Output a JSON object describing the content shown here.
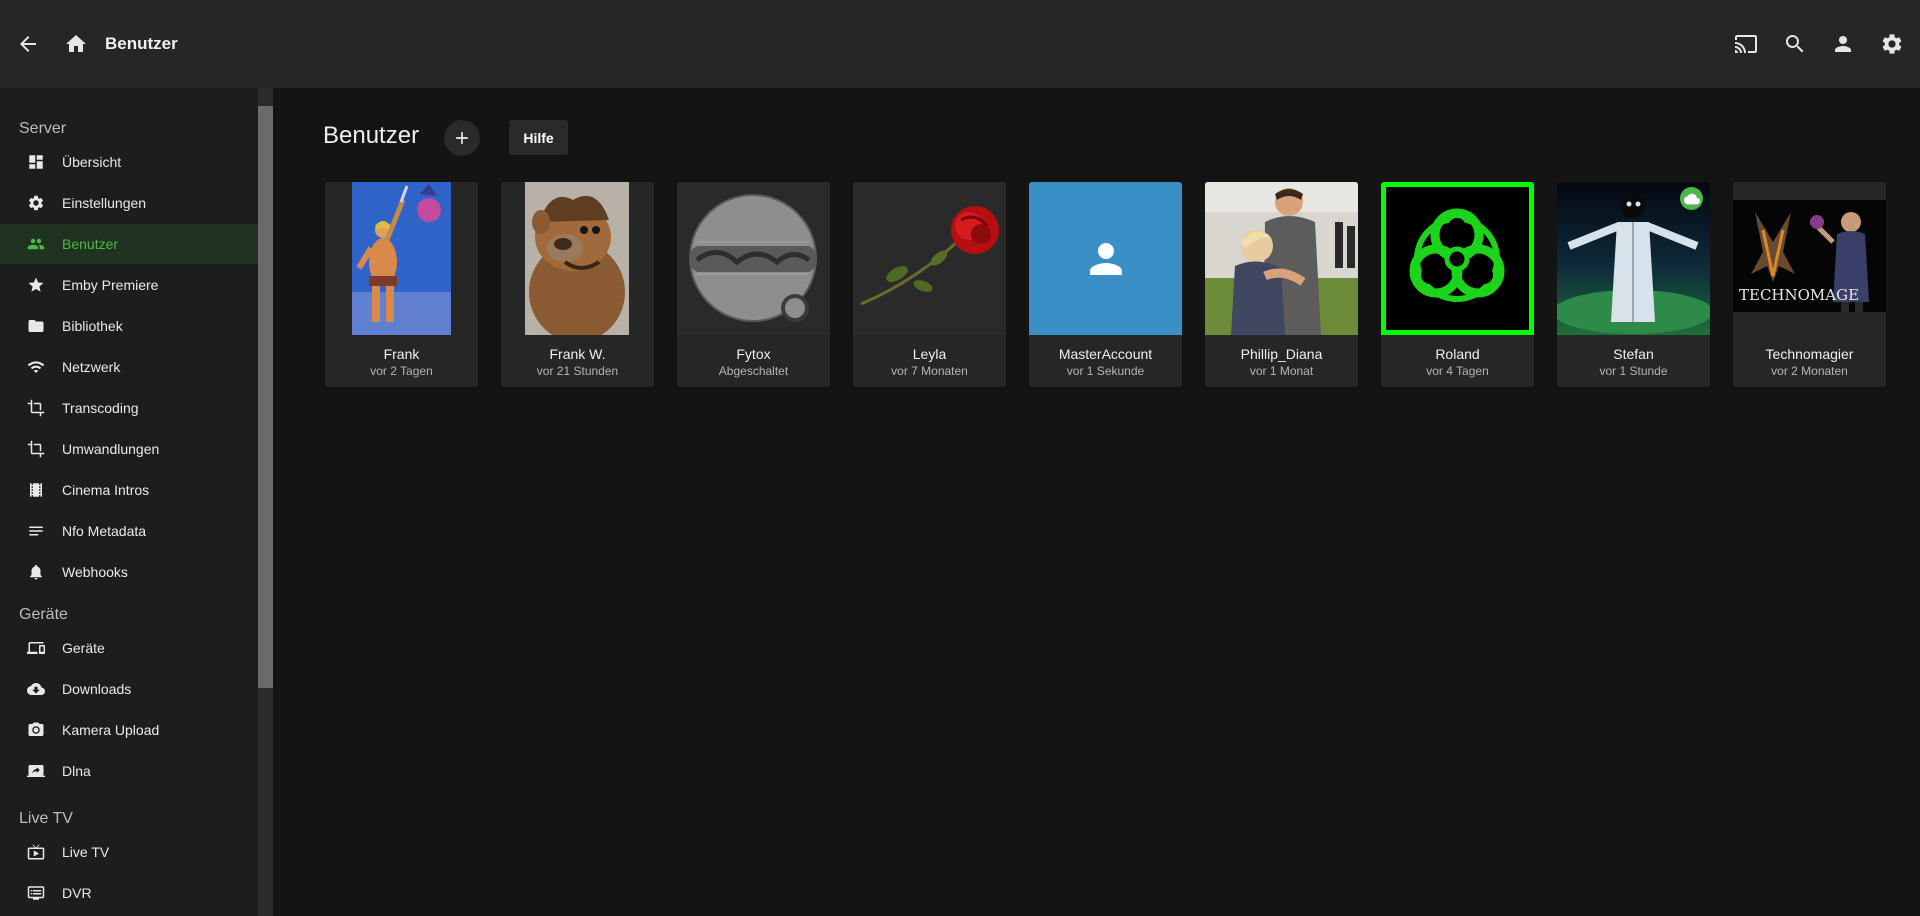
{
  "header": {
    "title": "Benutzer",
    "icons": [
      "back-arrow-icon",
      "home-icon",
      "cast-icon",
      "search-icon",
      "user-icon",
      "gear-icon"
    ]
  },
  "sidebar": {
    "sections": [
      {
        "title": "Server",
        "items": [
          {
            "label": "Übersicht",
            "icon": "dashboard-icon"
          },
          {
            "label": "Einstellungen",
            "icon": "settings-icon"
          },
          {
            "label": "Benutzer",
            "icon": "people-icon",
            "active": true
          },
          {
            "label": "Emby Premiere",
            "icon": "star-icon"
          },
          {
            "label": "Bibliothek",
            "icon": "folder-icon"
          },
          {
            "label": "Netzwerk",
            "icon": "wifi-icon"
          },
          {
            "label": "Transcoding",
            "icon": "crop-icon"
          },
          {
            "label": "Umwandlungen",
            "icon": "crop-icon"
          },
          {
            "label": "Cinema Intros",
            "icon": "film-icon"
          },
          {
            "label": "Nfo Metadata",
            "icon": "lines-icon"
          },
          {
            "label": "Webhooks",
            "icon": "bell-icon"
          }
        ]
      },
      {
        "title": "Geräte",
        "items": [
          {
            "label": "Geräte",
            "icon": "devices-icon"
          },
          {
            "label": "Downloads",
            "icon": "cloud-download-icon"
          },
          {
            "label": "Kamera Upload",
            "icon": "camera-icon"
          },
          {
            "label": "Dlna",
            "icon": "screen-share-icon"
          }
        ]
      },
      {
        "title": "Live TV",
        "items": [
          {
            "label": "Live TV",
            "icon": "tv-icon"
          },
          {
            "label": "DVR",
            "icon": "dvr-icon"
          }
        ]
      }
    ]
  },
  "main": {
    "title": "Benutzer",
    "help_label": "Hilfe",
    "users": [
      {
        "name": "Frank",
        "status": "vor 2 Tagen"
      },
      {
        "name": "Frank W.",
        "status": "vor 21 Stunden"
      },
      {
        "name": "Fytox",
        "status": "Abgeschaltet"
      },
      {
        "name": "Leyla",
        "status": "vor 7 Monaten"
      },
      {
        "name": "MasterAccount",
        "status": "vor 1 Sekunde"
      },
      {
        "name": "Phillip_Diana",
        "status": "vor 1 Monat"
      },
      {
        "name": "Roland",
        "status": "vor 4 Tagen"
      },
      {
        "name": "Stefan",
        "status": "vor 1 Stunde"
      },
      {
        "name": "Technomagier",
        "status": "vor 2 Monaten",
        "image_text": "TECHNOMAGE"
      }
    ]
  },
  "colors": {
    "accent": "#52b54b",
    "header_bg": "#262626",
    "sidebar_bg": "#1d1d1d",
    "page_bg": "#141414",
    "card_bg": "#262626",
    "master_avatar_bg": "#3a8fc6",
    "roland_border": "#00ff00"
  }
}
